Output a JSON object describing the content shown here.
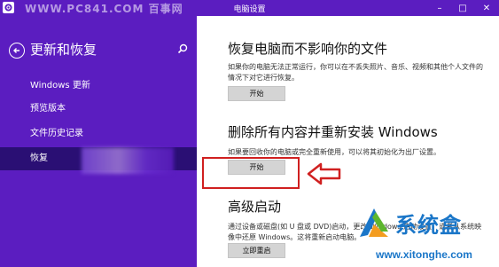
{
  "window": {
    "title": "电脑设置",
    "watermark": "WWW.PC841.COM 百事网",
    "controls": {
      "minimize": "–",
      "maximize": "□",
      "close": "✕"
    }
  },
  "sidebar": {
    "heading": "更新和恢复",
    "items": [
      {
        "label": "Windows 更新"
      },
      {
        "label": "预览版本"
      },
      {
        "label": "文件历史记录"
      },
      {
        "label": "恢复"
      }
    ]
  },
  "main": {
    "sections": [
      {
        "title": "恢复电脑而不影响你的文件",
        "desc": "如果你的电脑无法正常运行，你可以在不丢失照片、音乐、视频和其他个人文件的情况下对它进行恢复。",
        "button": "开始"
      },
      {
        "title": "删除所有内容并重新安装 Windows",
        "desc": "如果要回收你的电脑或完全重新使用，可以将其初始化为出厂设置。",
        "button": "开始"
      },
      {
        "title": "高级启动",
        "desc": "通过设备或磁盘(如 U 盘或 DVD)启动，更改 Windows 启动设置，或者从系统映像中还原 Windows。这将重新启动电脑。",
        "button": "立即重启"
      }
    ]
  },
  "logo": {
    "brand": "系统盒",
    "url": "www.xitonghe.com"
  },
  "colors": {
    "accent": "#5b1dc0",
    "sidebar_active": "#2a0f74",
    "highlight": "#d02020",
    "logo_blue": "#1a76c8"
  }
}
